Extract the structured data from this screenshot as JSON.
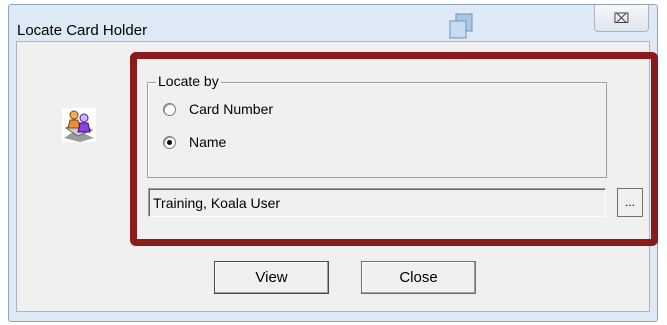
{
  "window": {
    "title": "Locate Card Holder",
    "close_glyph": "⌧"
  },
  "locate": {
    "group_label": "Locate by",
    "options": [
      {
        "label": "Card Number",
        "checked": false
      },
      {
        "label": "Name",
        "checked": true
      }
    ],
    "name_value": "Training, Koala User",
    "browse_label": "..."
  },
  "buttons": {
    "view_label": "View",
    "close_label": "Close"
  },
  "colors": {
    "highlight": "#8b1a1a",
    "frame": "#dde9f5"
  }
}
